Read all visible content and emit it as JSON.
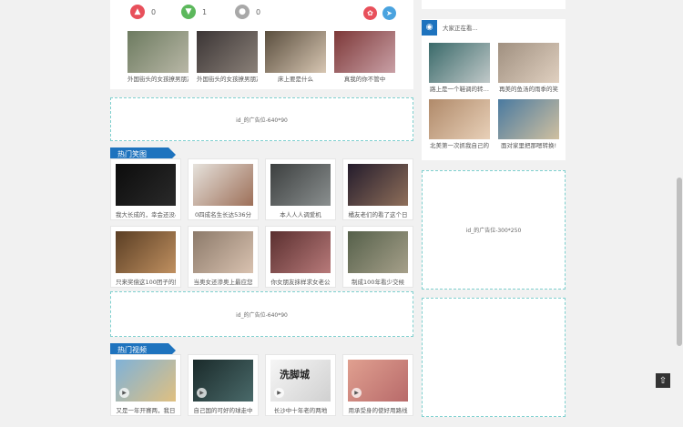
{
  "reactions": [
    {
      "icon": "thumbs-up-icon",
      "count": "0",
      "color": "#e8505b"
    },
    {
      "icon": "thumbs-down-icon",
      "count": "1",
      "color": "#5cb85c"
    },
    {
      "icon": "meh-icon",
      "count": "0",
      "color": "#a8a8a8"
    }
  ],
  "share": [
    {
      "icon": "weibo-icon",
      "color": "#e8505b"
    },
    {
      "icon": "share-icon",
      "color": "#4aa3df"
    }
  ],
  "related": [
    {
      "caption": "外国街头的女孩撩男朋友",
      "colors": [
        "#6d7b60",
        "#b8b7a6"
      ]
    },
    {
      "caption": "外国街头的女孩撩男朋友",
      "colors": [
        "#3b3535",
        "#8a8078"
      ]
    },
    {
      "caption": "床上要是什么",
      "colors": [
        "#5a4e3e",
        "#d7c6b2"
      ]
    },
    {
      "caption": "真我的你不管中",
      "colors": [
        "#7d3838",
        "#c9a0a6"
      ]
    }
  ],
  "ads": {
    "top": "id_的广告位-640*90",
    "middle": "id_的广告位-640*90",
    "side": "id_的广告位-300*250"
  },
  "hot_jokes": {
    "title": "热门笑图",
    "items": [
      {
        "caption": "我大长成的，幸会还没小",
        "colors": [
          "#0c0c0c",
          "#2a2a2a"
        ]
      },
      {
        "caption": "0四成名生长达536分",
        "colors": [
          "#e6e2dc",
          "#9d6f58"
        ]
      },
      {
        "caption": "本人人人调爱机",
        "colors": [
          "#3c3f3f",
          "#8a8f8f"
        ]
      },
      {
        "caption": "橘友老们的看了这个日",
        "colors": [
          "#241c2c",
          "#8f6f5a"
        ]
      },
      {
        "caption": "只来奖偿这100团子的妙",
        "colors": [
          "#5a3e24",
          "#c09060"
        ]
      },
      {
        "caption": "当奥女还渗奥上最应您",
        "colors": [
          "#8c7a6a",
          "#d9c2b0"
        ]
      },
      {
        "caption": "你女朋友抹样求女老公",
        "colors": [
          "#5a2f2f",
          "#b87a7a"
        ]
      },
      {
        "caption": "制成100年看少交候",
        "colors": [
          "#55604a",
          "#a6a08a"
        ]
      }
    ]
  },
  "hot_videos": {
    "title": "热门视频",
    "items": [
      {
        "caption": "又是一年开赛两，我日",
        "colors": [
          "#7fb2d8",
          "#e0c080"
        ]
      },
      {
        "caption": "自己国的可好的球走中",
        "colors": [
          "#1a2a2a",
          "#4a6a6a"
        ]
      },
      {
        "caption": "长沙中十年老的两地",
        "colors": [
          "#f6f6f6",
          "#d0d0d0"
        ],
        "overlay": "洗脚城"
      },
      {
        "caption": "用承受身的使好用路线",
        "colors": [
          "#e0a090",
          "#b86a6a"
        ]
      }
    ]
  },
  "sidebar": {
    "header": "大家正在看...",
    "items": [
      {
        "caption": "路上是一个鞋调的转…",
        "colors": [
          "#3a6a6a",
          "#c0c8c8"
        ]
      },
      {
        "caption": "再美的鱼汤的雨季的笑",
        "colors": [
          "#a09080",
          "#e0d0c0"
        ]
      },
      {
        "caption": "北美第一次抓我自己的",
        "colors": [
          "#b08a6a",
          "#e8d0b8"
        ]
      },
      {
        "caption": "面对家里把那嗯转换!",
        "colors": [
          "#4a7aa0",
          "#d0c0a0"
        ]
      }
    ]
  }
}
